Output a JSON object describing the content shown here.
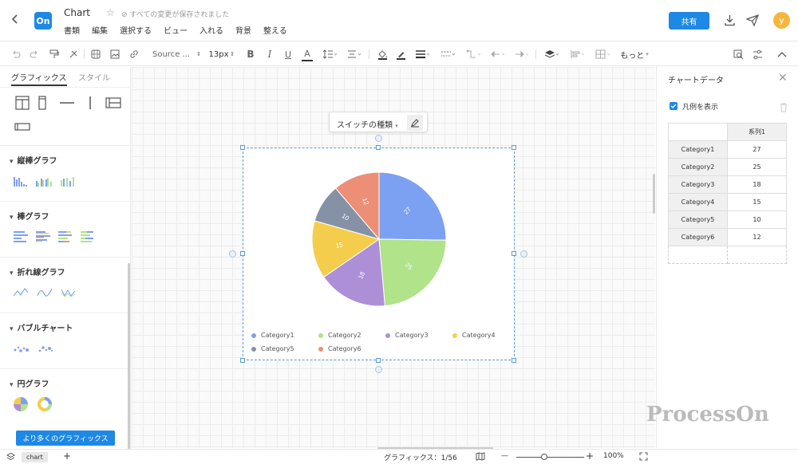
{
  "header": {
    "back_icon": "chevron-left-icon",
    "logo_text": "On",
    "title": "Chart",
    "saved_status": "すべての変更が保存されました",
    "menus": [
      "書類",
      "編集",
      "選択する",
      "ビュー",
      "入れる",
      "背景",
      "整える"
    ],
    "share_label": "共有",
    "avatar_letter": "y",
    "accent": "#1e88e5"
  },
  "toolbar": {
    "font_name": "Source ...",
    "font_size": "13px",
    "bold": "B",
    "italic": "I",
    "underline": "U",
    "font_color": "A",
    "more": "もっと"
  },
  "left_panel": {
    "tabs": [
      "グラフィックス",
      "スタイル"
    ],
    "sections": [
      "縦棒グラフ",
      "棒グラフ",
      "折れ線グラフ",
      "バブルチャート",
      "円グラフ"
    ],
    "more_button": "より多くのグラフィックス"
  },
  "canvas": {
    "switch_type_label": "スイッチの種類",
    "watermark": "ProcessOn"
  },
  "chart_data": {
    "type": "pie",
    "categories": [
      "Category1",
      "Category2",
      "Category3",
      "Category4",
      "Category5",
      "Category6"
    ],
    "values": [
      27,
      25,
      18,
      15,
      10,
      12
    ],
    "colors": [
      "#7da1f2",
      "#b0e38a",
      "#ad8fd8",
      "#f5cd4c",
      "#8592a6",
      "#ec8f76"
    ],
    "legend_position": "bottom"
  },
  "right_panel": {
    "title": "チャートデータ",
    "show_legend_label": "凡例を表示",
    "column_header": "系列1",
    "rows": [
      {
        "cat": "Category1",
        "val": "27"
      },
      {
        "cat": "Category2",
        "val": "25"
      },
      {
        "cat": "Category3",
        "val": "18"
      },
      {
        "cat": "Category4",
        "val": "15"
      },
      {
        "cat": "Category5",
        "val": "10"
      },
      {
        "cat": "Category6",
        "val": "12"
      }
    ]
  },
  "status_bar": {
    "page_tab": "chart",
    "add": "+",
    "graphics_count": "グラフィックス：1/56",
    "zoom_minus": "—",
    "zoom_plus": "+",
    "zoom_level": "100%"
  }
}
